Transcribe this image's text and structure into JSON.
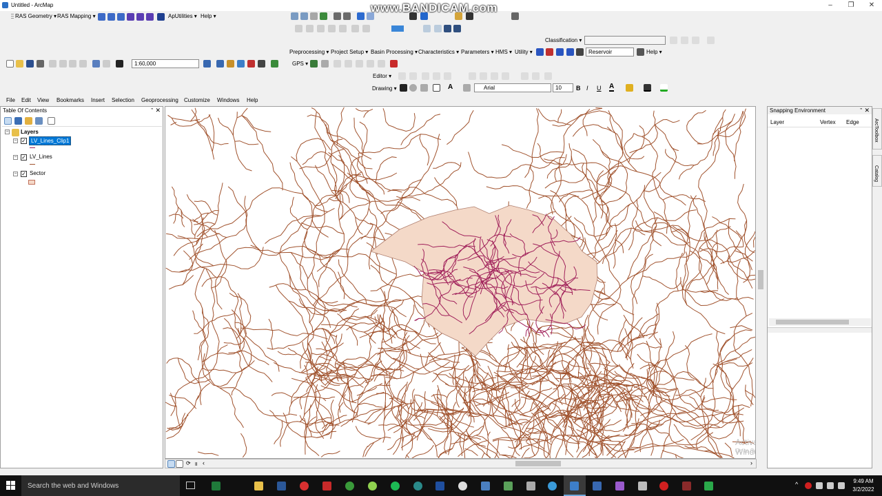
{
  "window": {
    "title": "Untitled - ArcMap"
  },
  "watermark": "www.BANDICAM.com",
  "toolbar1": {
    "ras_geometry": "RAS Geometry ▾",
    "ras_mapping": "RAS Mapping ▾",
    "aputilities": "ApUtilities ▾",
    "help": "Help ▾"
  },
  "classification": {
    "label": "Classification ▾"
  },
  "hec_toolbar": {
    "items": [
      "Preprocessing ▾",
      "Project Setup ▾",
      "Basin Processing ▾",
      "Characteristics ▾",
      "Parameters ▾",
      "HMS ▾",
      "Utility ▾"
    ],
    "reservoir": "Reservoir",
    "help": "Help ▾"
  },
  "standard": {
    "scale": "1:60,000",
    "gps": "GPS ▾"
  },
  "editor": {
    "label": "Editor ▾"
  },
  "drawing": {
    "label": "Drawing ▾",
    "font": "Arial",
    "size": "10",
    "bold": "B",
    "italic": "I",
    "underline": "U",
    "text_a": "A"
  },
  "menu": [
    "File",
    "Edit",
    "View",
    "Bookmarks",
    "Insert",
    "Selection",
    "Geoprocessing",
    "Customize",
    "Windows",
    "Help"
  ],
  "toc": {
    "title": "Table Of Contents",
    "root": "Layers",
    "layers": [
      "LV_Lines_Clip1",
      "LV_Lines",
      "Sector"
    ]
  },
  "snapping": {
    "title": "Snapping Environment",
    "columns": [
      "Layer",
      "Vertex",
      "Edge"
    ]
  },
  "side_tabs": [
    "ArcToolbox",
    "Catalog"
  ],
  "activation": {
    "line1": "Activate Windows",
    "line2": "Go to Settings to activate Windows."
  },
  "taskbar": {
    "search": "Search the web and Windows",
    "time": "9:49 AM",
    "date": "3/2/2022"
  },
  "colors": {
    "line": "#a0522d",
    "clip_line": "#a0205a",
    "sector_fill": "#f4d9c8",
    "accent": "#0078d7"
  }
}
